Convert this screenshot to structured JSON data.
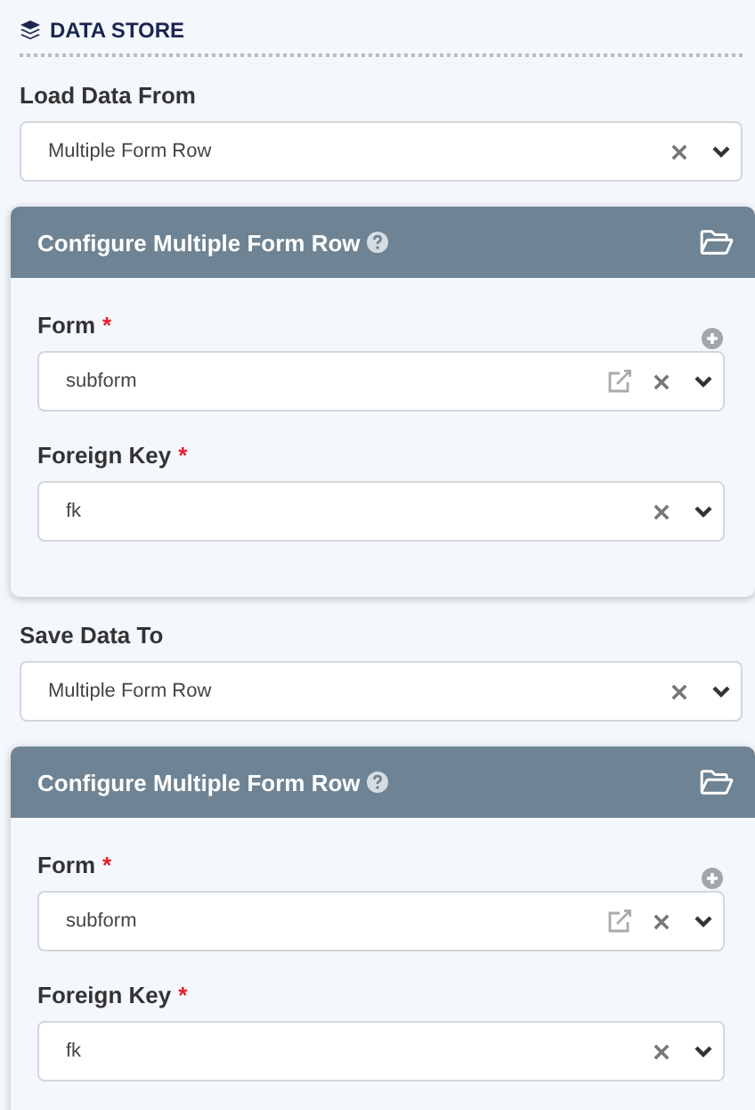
{
  "header": {
    "title": "DATA STORE"
  },
  "sections": [
    {
      "label": "Load Data From",
      "value": "Multiple Form Row",
      "panel": {
        "title": "Configure Multiple Form Row",
        "fields": [
          {
            "kind": "form",
            "label": "Form",
            "required_mark": "*",
            "value": "subform"
          },
          {
            "kind": "key",
            "label": "Foreign Key",
            "required_mark": "*",
            "value": "fk"
          }
        ]
      }
    },
    {
      "label": "Save Data To",
      "value": "Multiple Form Row",
      "panel": {
        "title": "Configure Multiple Form Row",
        "fields": [
          {
            "kind": "form",
            "label": "Form",
            "required_mark": "*",
            "value": "subform"
          },
          {
            "kind": "key",
            "label": "Foreign Key",
            "required_mark": "*",
            "value": "fk"
          }
        ]
      }
    }
  ]
}
